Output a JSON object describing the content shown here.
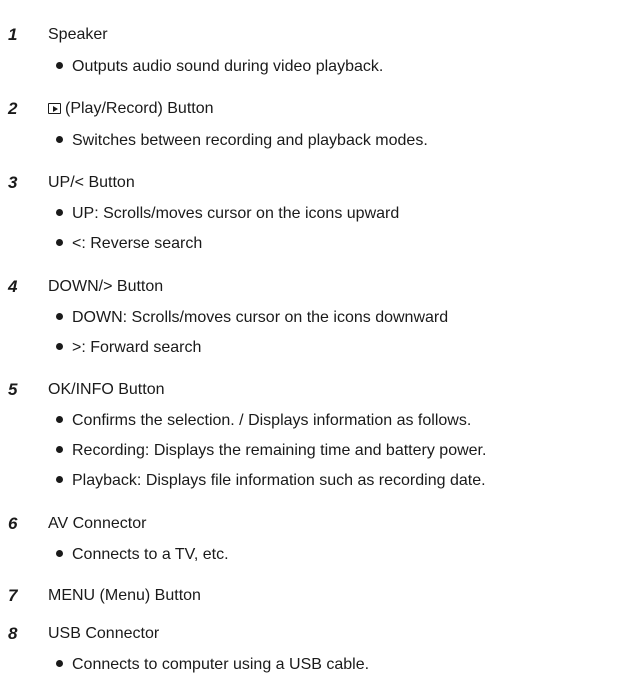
{
  "items": [
    {
      "number": "1",
      "title": "Speaker",
      "bullets": [
        "Outputs audio sound during video playback."
      ]
    },
    {
      "number": "2",
      "icon": "play-record-icon",
      "title": "(Play/Record) Button",
      "bullets": [
        "Switches between recording and playback modes."
      ]
    },
    {
      "number": "3",
      "title": "UP/< Button",
      "bullets": [
        "UP: Scrolls/moves cursor on the icons upward",
        "<: Reverse search"
      ]
    },
    {
      "number": "4",
      "title": "DOWN/> Button",
      "bullets": [
        "DOWN: Scrolls/moves cursor on the icons downward",
        ">: Forward search"
      ]
    },
    {
      "number": "5",
      "title": "OK/INFO Button",
      "bullets": [
        "Confirms the selection. / Displays information as follows.",
        "Recording: Displays the remaining time and battery power.",
        "Playback: Displays file information such as recording date."
      ]
    },
    {
      "number": "6",
      "title": "AV Connector",
      "bullets": [
        "Connects to a TV, etc."
      ]
    },
    {
      "number": "7",
      "title": "MENU (Menu) Button",
      "bullets": []
    },
    {
      "number": "8",
      "title": "USB Connector",
      "bullets": [
        "Connects to computer using a USB cable."
      ]
    }
  ]
}
